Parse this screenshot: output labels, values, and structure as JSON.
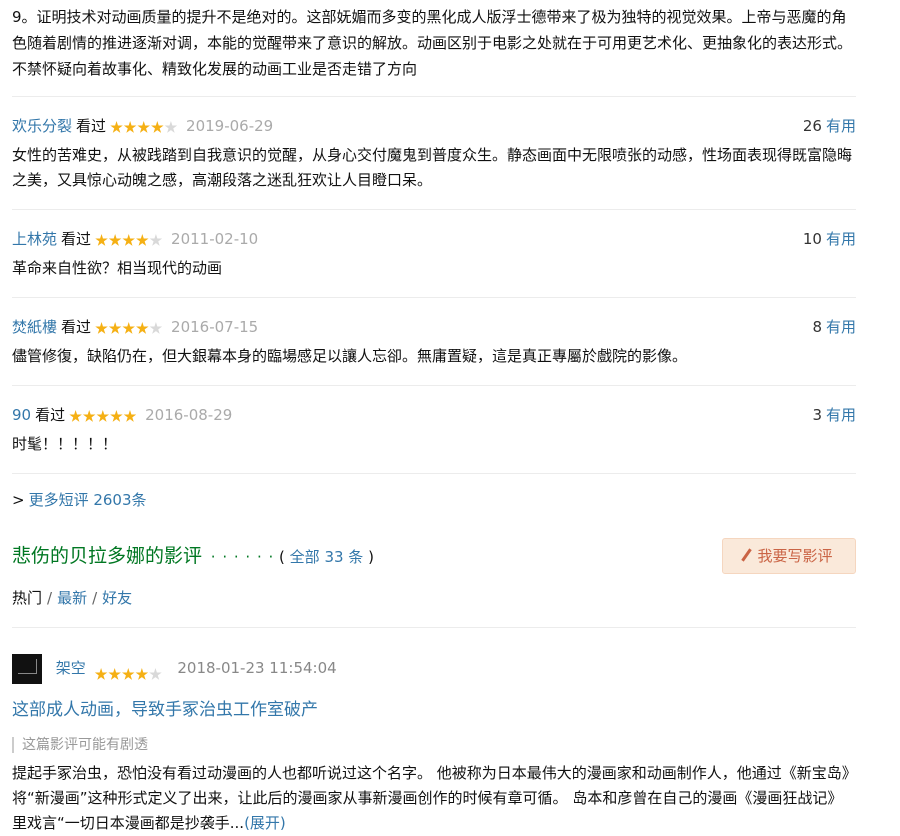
{
  "intro_text": "9。证明技术对动画质量的提升不是绝对的。这部妩媚而多变的黑化成人版浮士德带来了极为独特的视觉效果。上帝与恶魔的角色随着剧情的推进逐渐对调，本能的觉醒带来了意识的解放。动画区别于电影之处就在于可用更艺术化、更抽象化的表达形式。不禁怀疑向着故事化、精致化发展的动画工业是否走错了方向",
  "comments": [
    {
      "user": "欢乐分裂",
      "status": "看过",
      "rating": 4,
      "date": "2019-06-29",
      "votes": "26",
      "useful": "有用",
      "text": "女性的苦难史，从被践踏到自我意识的觉醒，从身心交付魔鬼到普度众生。静态画面中无限喷张的动感，性场面表现得既富隐晦之美，又具惊心动魄之感，高潮段落之迷乱狂欢让人目瞪口呆。"
    },
    {
      "user": "上林苑",
      "status": "看过",
      "rating": 4,
      "date": "2011-02-10",
      "votes": "10",
      "useful": "有用",
      "text": "革命来自性欲？相当现代的动画"
    },
    {
      "user": "焚紙樓",
      "status": "看过",
      "rating": 4,
      "date": "2016-07-15",
      "votes": "8",
      "useful": "有用",
      "text": "儘管修復，缺陷仍在，但大銀幕本身的臨場感足以讓人忘卻。無庸置疑，這是真正專屬於戲院的影像。"
    },
    {
      "user": "90",
      "status": "看过",
      "rating": 5,
      "date": "2016-08-29",
      "votes": "3",
      "useful": "有用",
      "text": "时髦！！！！！"
    }
  ],
  "more_comments": {
    "arrow": ">",
    "label": "更多短评 2603条"
  },
  "reviews_section": {
    "title": "悲伤的贝拉多娜的影评",
    "dots": "· · · · · ·",
    "open_paren": "(",
    "all_label": "全部 33 条",
    "close_paren": ")",
    "write_label": "我要写影评",
    "tabs": {
      "hot": "热门",
      "latest": "最新",
      "friends": "好友",
      "sep": "/"
    }
  },
  "review": {
    "user": "架空",
    "rating": 4,
    "date": "2018-01-23 11:54:04",
    "title": "这部成人动画，导致手冢治虫工作室破产",
    "spoiler": "这篇影评可能有剧透",
    "excerpt": "提起手冢治虫，恐怕没有看过动漫画的人也都听说过这个名字。 他被称为日本最伟大的漫画家和动画制作人，他通过《新宝岛》将“新漫画”这种形式定义了出来，让此后的漫画家从事新漫画创作的时候有章可循。 岛本和彦曾在自己的漫画《漫画狂战记》里戏言“一切日本漫画都是抄袭手...",
    "expand": "(展开)"
  },
  "colors": {
    "link": "#3377aa",
    "section_title": "#007722",
    "star": "#f5b014",
    "button_bg": "#fae9da",
    "button_text": "#ca6445"
  }
}
